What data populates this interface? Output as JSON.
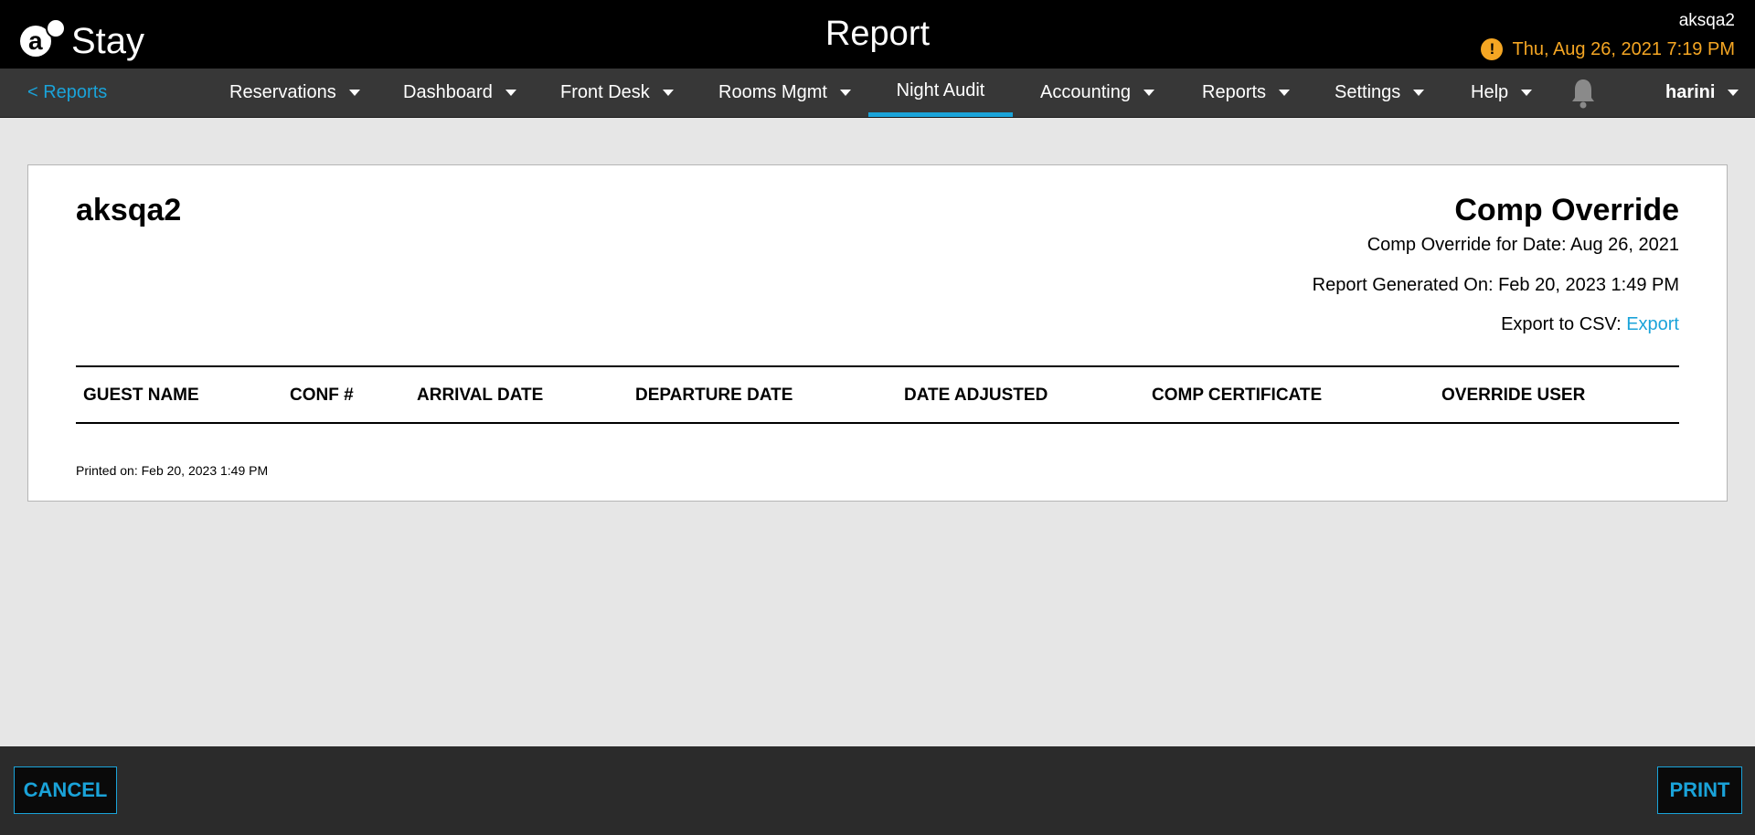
{
  "app": {
    "logo_letter": "a",
    "logo_text": "Stay",
    "page_title": "Report"
  },
  "top_right": {
    "user": "aksqa2",
    "date": "Thu, Aug 26, 2021 7:19 PM",
    "warning_icon": "!"
  },
  "nav": {
    "back_label": "< Reports",
    "items": [
      {
        "label": "Reservations"
      },
      {
        "label": "Dashboard"
      },
      {
        "label": "Front Desk"
      },
      {
        "label": "Rooms Mgmt"
      },
      {
        "label": "Night Audit"
      },
      {
        "label": "Accounting"
      },
      {
        "label": "Reports"
      },
      {
        "label": "Settings"
      },
      {
        "label": "Help"
      }
    ],
    "user": "harini",
    "active_item": "Night Audit"
  },
  "report": {
    "property": "aksqa2",
    "title": "Comp Override",
    "date_line": "Comp Override for Date: Aug 26, 2021",
    "generated_line": "Report Generated On: Feb 20, 2023 1:49 PM",
    "export_prefix": "Export to CSV: ",
    "export_link": "Export",
    "columns": [
      "GUEST NAME",
      "CONF #",
      "ARRIVAL DATE",
      "DEPARTURE DATE",
      "DATE ADJUSTED",
      "COMP CERTIFICATE",
      "OVERRIDE USER"
    ],
    "printed_on": "Printed on: Feb 20, 2023 1:49 PM"
  },
  "footer": {
    "cancel_label": "CANCEL",
    "print_label": "PRINT"
  },
  "colors": {
    "accent": "#1aa3d9",
    "warning": "#f5a623",
    "topbar": "#000000",
    "navbar": "#373737"
  }
}
